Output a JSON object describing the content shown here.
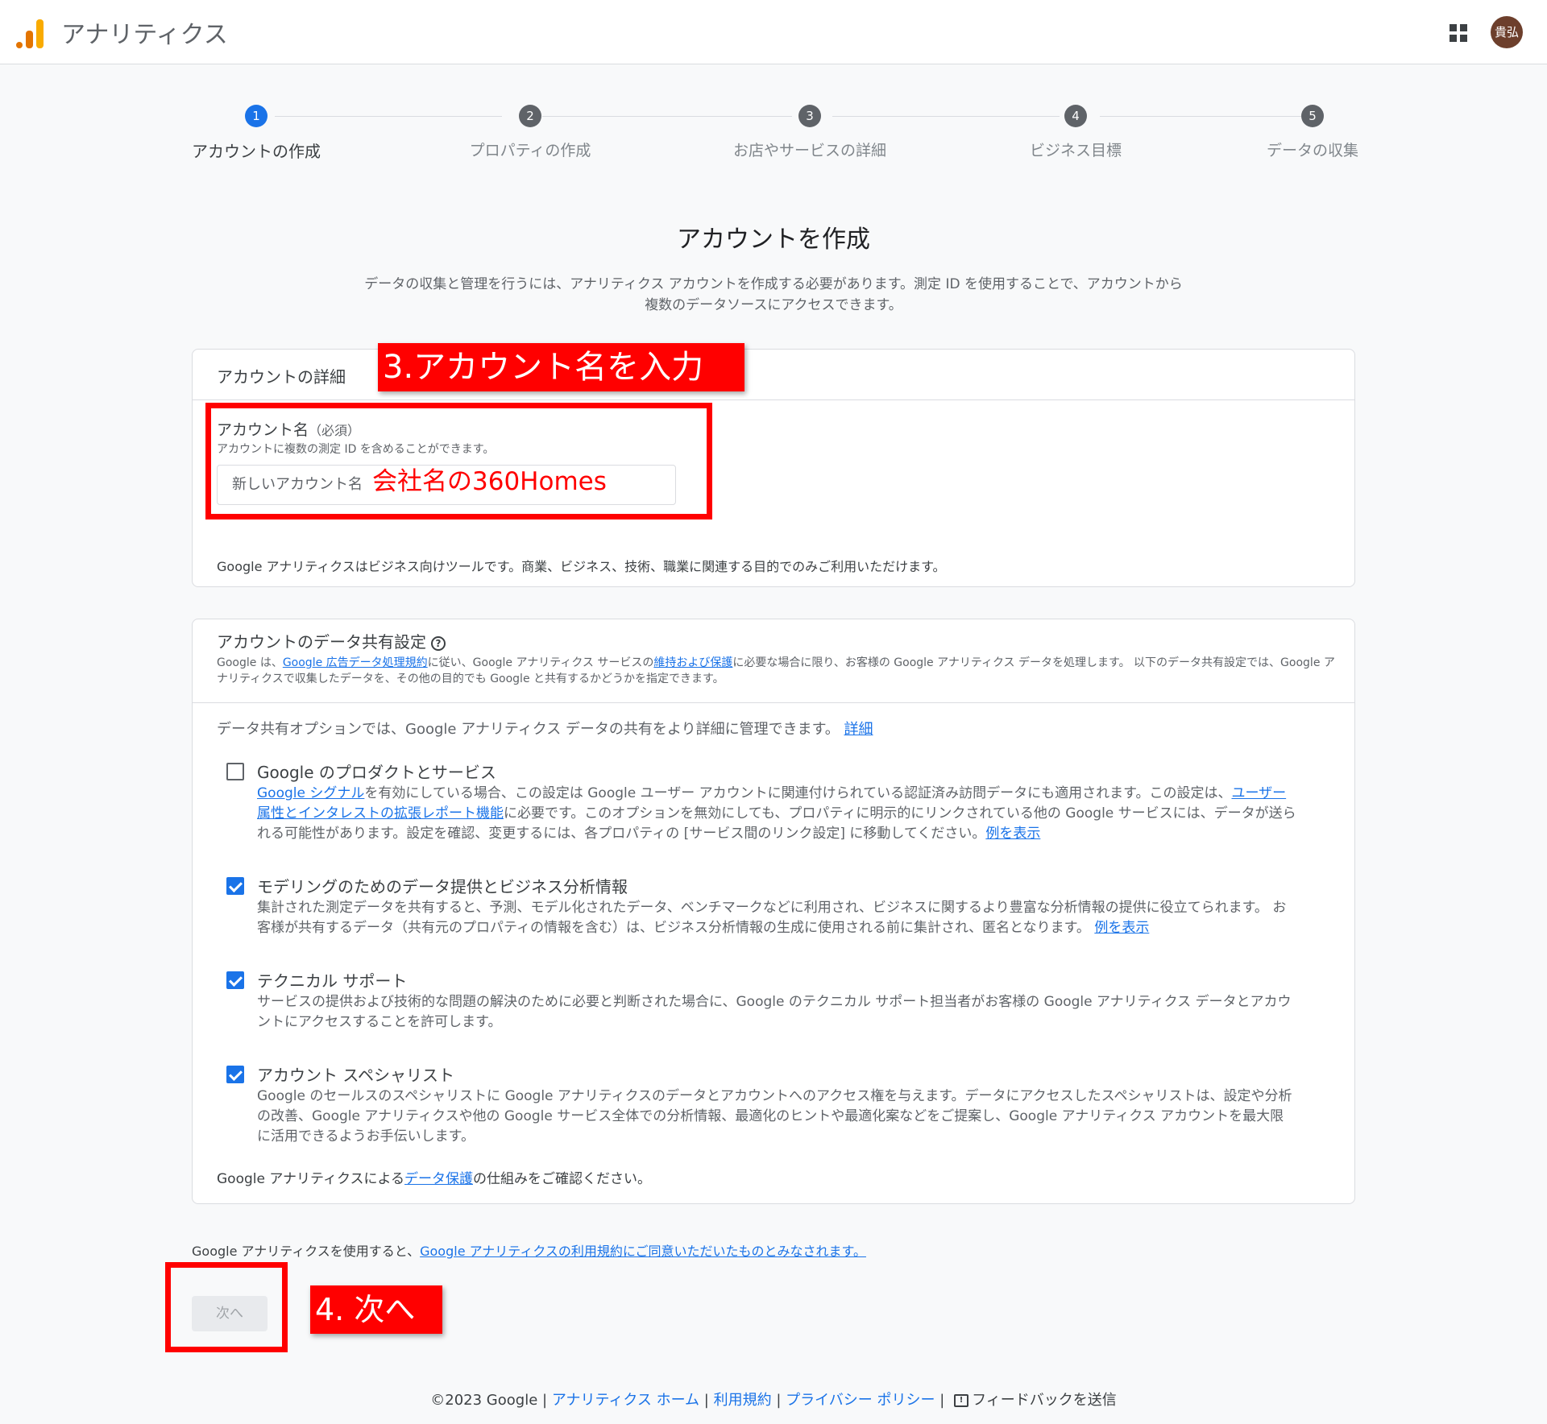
{
  "header": {
    "app_title": "アナリティクス",
    "avatar_text": "貴弘"
  },
  "steps": [
    {
      "num": "1",
      "label": "アカウントの作成",
      "active": true
    },
    {
      "num": "2",
      "label": "プロパティの作成"
    },
    {
      "num": "3",
      "label": "お店やサービスの詳細"
    },
    {
      "num": "4",
      "label": "ビジネス目標"
    },
    {
      "num": "5",
      "label": "データの収集"
    }
  ],
  "page": {
    "title": "アカウントを作成",
    "description": "データの収集と管理を行うには、アナリティクス アカウントを作成する必要があります。測定 ID を使用することで、アカウントから複数のデータソースにアクセスできます。"
  },
  "account_details": {
    "heading": "アカウントの詳細",
    "field_label": "アカウント名",
    "field_required": "（必須）",
    "field_hint": "アカウントに複数の測定 ID を含めることができます。",
    "input_placeholder": "新しいアカウント名",
    "note": "Google アナリティクスはビジネス向けツールです。商業、ビジネス、技術、職業に関連する目的でのみご利用いただけます。"
  },
  "data_sharing": {
    "heading": "アカウントのデータ共有設定",
    "desc_1": "Google は、",
    "desc_link1": "Google 広告データ処理規約",
    "desc_2": "に従い、Google アナリティクス サービスの",
    "desc_link2": "維持および保護",
    "desc_3": "に必要な場合に限り、お客様の Google アナリティクス データを処理します。 以下のデータ共有設定では、Google アナリティクスで収集したデータを、その他の目的でも Google と共有するかどうかを指定できます。",
    "intro": "データ共有オプションでは、Google アナリティクス データの共有をより詳細に管理できます。",
    "intro_link": "詳細",
    "options": [
      {
        "title": "Google のプロダクトとサービス",
        "checked": false,
        "link_a": "Google シグナル",
        "text_a": "を有効にしている場合、この設定は Google ユーザー アカウントに関連付けられている認証済み訪問データにも適用されます。この設定は、",
        "link_b": "ユーザー属性とインタレストの拡張レポート機能",
        "text_b": "に必要です。このオプションを無効にしても、プロパティに明示的にリンクされている他の Google サービスには、データが送られる可能性があります。設定を確認、変更するには、各プロパティの [サービス間のリンク設定] に移動してください。",
        "link_c": "例を表示"
      },
      {
        "title": "モデリングのためのデータ提供とビジネス分析情報",
        "checked": true,
        "text_a": "集計された測定データを共有すると、予測、モデル化されたデータ、ベンチマークなどに利用され、ビジネスに関するより豊富な分析情報の提供に役立てられます。 お客様が共有するデータ（共有元のプロパティの情報を含む）は、ビジネス分析情報の生成に使用される前に集計され、匿名となります。",
        "link_c": "例を表示"
      },
      {
        "title": "テクニカル サポート",
        "checked": true,
        "text_a": "サービスの提供および技術的な問題の解決のために必要と判断された場合に、Google のテクニカル サポート担当者がお客様の Google アナリティクス データとアカウントにアクセスすることを許可します。"
      },
      {
        "title": "アカウント スペシャリスト",
        "checked": true,
        "text_a": "Google のセールスのスペシャリストに Google アナリティクスのデータとアカウントへのアクセス権を与えます。データにアクセスしたスペシャリストは、設定や分析の改善、Google アナリティクスや他の Google サービス全体での分析情報、最適化のヒントや最適化案などをご提案し、Google アナリティクス アカウントを最大限に活用できるようお手伝いします。"
      }
    ],
    "footer_1": "Google アナリティクスによる",
    "footer_link": "データ保護",
    "footer_2": "の仕組みをご確認ください。"
  },
  "terms": {
    "text": "Google アナリティクスを使用すると、",
    "link": "Google アナリティクスの利用規約にご同意いただいたものとみなされます。"
  },
  "next_button": "次へ",
  "footer": {
    "copyright": "©2023 Google",
    "sep": "|",
    "link_home": "アナリティクス ホーム",
    "link_terms": "利用規約",
    "link_privacy": "プライバシー ポリシー",
    "feedback": "フィードバックを送信"
  },
  "annotations": {
    "step3": "3.アカウント名を入力",
    "input_example": "会社名の360Homes",
    "step4": "4.  次へ"
  }
}
